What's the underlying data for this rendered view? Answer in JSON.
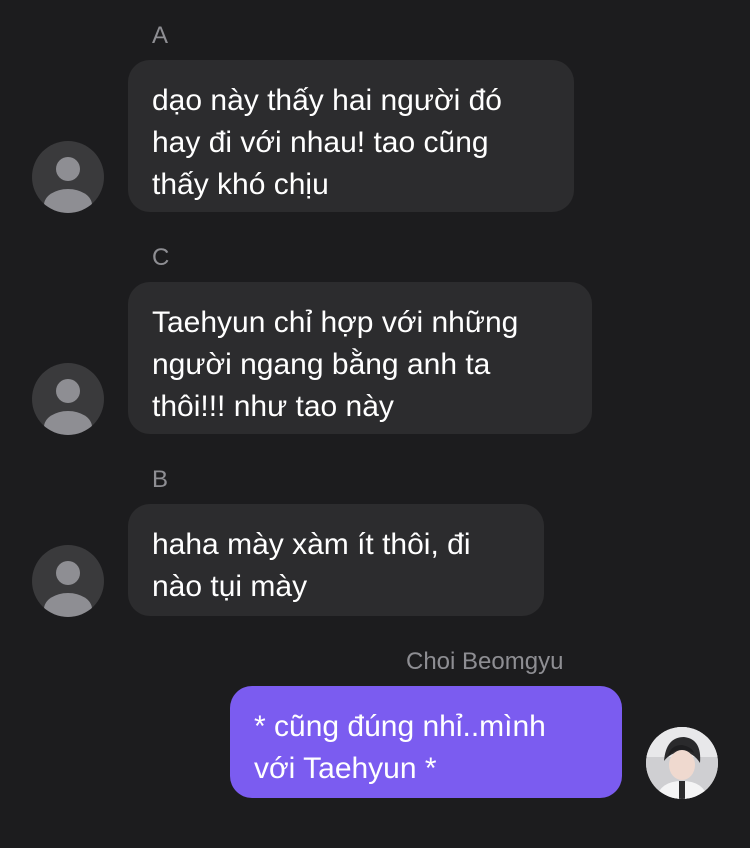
{
  "messages": [
    {
      "sender": "A",
      "text": "dạo này thấy hai người đó\nhay đi với nhau! tao cũng\nthấy khó chịu",
      "direction": "incoming"
    },
    {
      "sender": "C",
      "text": "Taehyun chỉ hợp với những\nngười ngang bằng anh ta\nthôi!!! như tao này",
      "direction": "incoming"
    },
    {
      "sender": "B",
      "text": "haha mày xàm ít thôi, đi\nnào tụi mày",
      "direction": "incoming"
    },
    {
      "sender": "Choi Beomgyu",
      "text": "* cũng đúng nhỉ..mình\nvới Taehyun *",
      "direction": "outgoing"
    }
  ],
  "colors": {
    "background": "#1c1c1e",
    "incoming_bubble": "#2c2c2e",
    "outgoing_bubble": "#7b5cf0",
    "sender_name": "#8e8e93"
  },
  "icons": {
    "default_avatar": "person-silhouette-icon",
    "user_avatar": "profile-photo"
  }
}
